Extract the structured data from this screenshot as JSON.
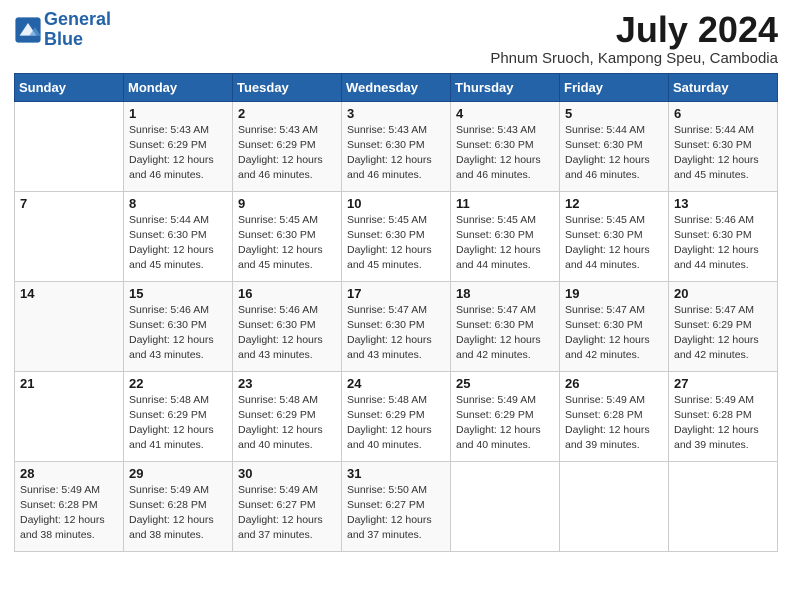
{
  "logo": {
    "line1": "General",
    "line2": "Blue"
  },
  "title": "July 2024",
  "location": "Phnum Sruoch, Kampong Speu, Cambodia",
  "days_of_week": [
    "Sunday",
    "Monday",
    "Tuesday",
    "Wednesday",
    "Thursday",
    "Friday",
    "Saturday"
  ],
  "weeks": [
    [
      {
        "day": "",
        "info": ""
      },
      {
        "day": "1",
        "info": "Sunrise: 5:43 AM\nSunset: 6:29 PM\nDaylight: 12 hours\nand 46 minutes."
      },
      {
        "day": "2",
        "info": "Sunrise: 5:43 AM\nSunset: 6:29 PM\nDaylight: 12 hours\nand 46 minutes."
      },
      {
        "day": "3",
        "info": "Sunrise: 5:43 AM\nSunset: 6:30 PM\nDaylight: 12 hours\nand 46 minutes."
      },
      {
        "day": "4",
        "info": "Sunrise: 5:43 AM\nSunset: 6:30 PM\nDaylight: 12 hours\nand 46 minutes."
      },
      {
        "day": "5",
        "info": "Sunrise: 5:44 AM\nSunset: 6:30 PM\nDaylight: 12 hours\nand 46 minutes."
      },
      {
        "day": "6",
        "info": "Sunrise: 5:44 AM\nSunset: 6:30 PM\nDaylight: 12 hours\nand 45 minutes."
      }
    ],
    [
      {
        "day": "7",
        "info": ""
      },
      {
        "day": "8",
        "info": "Sunrise: 5:44 AM\nSunset: 6:30 PM\nDaylight: 12 hours\nand 45 minutes."
      },
      {
        "day": "9",
        "info": "Sunrise: 5:45 AM\nSunset: 6:30 PM\nDaylight: 12 hours\nand 45 minutes."
      },
      {
        "day": "10",
        "info": "Sunrise: 5:45 AM\nSunset: 6:30 PM\nDaylight: 12 hours\nand 45 minutes."
      },
      {
        "day": "11",
        "info": "Sunrise: 5:45 AM\nSunset: 6:30 PM\nDaylight: 12 hours\nand 44 minutes."
      },
      {
        "day": "12",
        "info": "Sunrise: 5:45 AM\nSunset: 6:30 PM\nDaylight: 12 hours\nand 44 minutes."
      },
      {
        "day": "13",
        "info": "Sunrise: 5:46 AM\nSunset: 6:30 PM\nDaylight: 12 hours\nand 44 minutes."
      }
    ],
    [
      {
        "day": "14",
        "info": ""
      },
      {
        "day": "15",
        "info": "Sunrise: 5:46 AM\nSunset: 6:30 PM\nDaylight: 12 hours\nand 43 minutes."
      },
      {
        "day": "16",
        "info": "Sunrise: 5:46 AM\nSunset: 6:30 PM\nDaylight: 12 hours\nand 43 minutes."
      },
      {
        "day": "17",
        "info": "Sunrise: 5:47 AM\nSunset: 6:30 PM\nDaylight: 12 hours\nand 43 minutes."
      },
      {
        "day": "18",
        "info": "Sunrise: 5:47 AM\nSunset: 6:30 PM\nDaylight: 12 hours\nand 42 minutes."
      },
      {
        "day": "19",
        "info": "Sunrise: 5:47 AM\nSunset: 6:30 PM\nDaylight: 12 hours\nand 42 minutes."
      },
      {
        "day": "20",
        "info": "Sunrise: 5:47 AM\nSunset: 6:29 PM\nDaylight: 12 hours\nand 42 minutes."
      }
    ],
    [
      {
        "day": "21",
        "info": ""
      },
      {
        "day": "22",
        "info": "Sunrise: 5:48 AM\nSunset: 6:29 PM\nDaylight: 12 hours\nand 41 minutes."
      },
      {
        "day": "23",
        "info": "Sunrise: 5:48 AM\nSunset: 6:29 PM\nDaylight: 12 hours\nand 40 minutes."
      },
      {
        "day": "24",
        "info": "Sunrise: 5:48 AM\nSunset: 6:29 PM\nDaylight: 12 hours\nand 40 minutes."
      },
      {
        "day": "25",
        "info": "Sunrise: 5:49 AM\nSunset: 6:29 PM\nDaylight: 12 hours\nand 40 minutes."
      },
      {
        "day": "26",
        "info": "Sunrise: 5:49 AM\nSunset: 6:28 PM\nDaylight: 12 hours\nand 39 minutes."
      },
      {
        "day": "27",
        "info": "Sunrise: 5:49 AM\nSunset: 6:28 PM\nDaylight: 12 hours\nand 39 minutes."
      }
    ],
    [
      {
        "day": "28",
        "info": "Sunrise: 5:49 AM\nSunset: 6:28 PM\nDaylight: 12 hours\nand 38 minutes."
      },
      {
        "day": "29",
        "info": "Sunrise: 5:49 AM\nSunset: 6:28 PM\nDaylight: 12 hours\nand 38 minutes."
      },
      {
        "day": "30",
        "info": "Sunrise: 5:49 AM\nSunset: 6:27 PM\nDaylight: 12 hours\nand 37 minutes."
      },
      {
        "day": "31",
        "info": "Sunrise: 5:50 AM\nSunset: 6:27 PM\nDaylight: 12 hours\nand 37 minutes."
      },
      {
        "day": "",
        "info": ""
      },
      {
        "day": "",
        "info": ""
      },
      {
        "day": "",
        "info": ""
      }
    ]
  ]
}
